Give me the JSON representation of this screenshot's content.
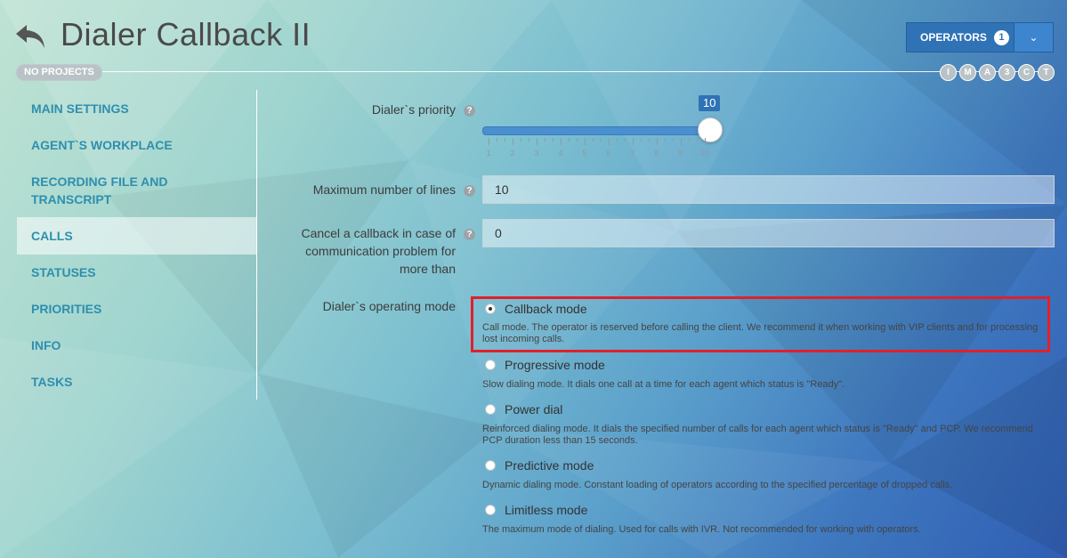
{
  "header": {
    "title": "Dialer Callback II",
    "no_projects": "NO PROJECTS",
    "badges": [
      "I",
      "M",
      "A",
      "3",
      "C",
      "T"
    ],
    "operators_label": "OPERATORS",
    "operators_count": "1"
  },
  "sidebar": {
    "items": [
      {
        "label": "MAIN SETTINGS"
      },
      {
        "label": "AGENT`S WORKPLACE"
      },
      {
        "label": "RECORDING FILE AND TRANSCRIPT"
      },
      {
        "label": "CALLS"
      },
      {
        "label": "STATUSES"
      },
      {
        "label": "PRIORITIES"
      },
      {
        "label": "INFO"
      },
      {
        "label": "TASKS"
      }
    ],
    "active": "CALLS"
  },
  "form": {
    "priority_label": "Dialer`s priority",
    "priority_value": "10",
    "priority_ticks": [
      "1",
      "2",
      "3",
      "4",
      "5",
      "6",
      "7",
      "8",
      "9",
      "10"
    ],
    "max_lines_label": "Maximum number of lines",
    "max_lines_value": "10",
    "cancel_label": "Cancel a callback in case of communication problem for more than",
    "cancel_value": "0",
    "mode_label": "Dialer`s operating mode",
    "modes": [
      {
        "label": "Callback mode",
        "desc": "Call mode. The operator is reserved before calling the client. We recommend it when working with VIP clients and for processing lost incoming calls.",
        "checked": true
      },
      {
        "label": "Progressive mode",
        "desc": "Slow dialing mode. It dials one call at a time for each agent which status is \"Ready\".",
        "checked": false
      },
      {
        "label": "Power dial",
        "desc": "Reinforced dialing mode. It dials the specified number of calls for each agent which status is \"Ready\" and PCP. We recommend PCP duration less than 15 seconds.",
        "checked": false
      },
      {
        "label": "Predictive mode",
        "desc": "Dynamic dialing mode. Constant loading of operators according to the specified percentage of dropped calls.",
        "checked": false
      },
      {
        "label": "Limitless mode",
        "desc": "The maximum mode of dialing. Used for calls with IVR. Not recommended for working with operators.",
        "checked": false
      }
    ]
  },
  "colors": {
    "accent": "#2f73b6",
    "nav_text": "#2f8fae",
    "highlight": "#e0202b"
  }
}
